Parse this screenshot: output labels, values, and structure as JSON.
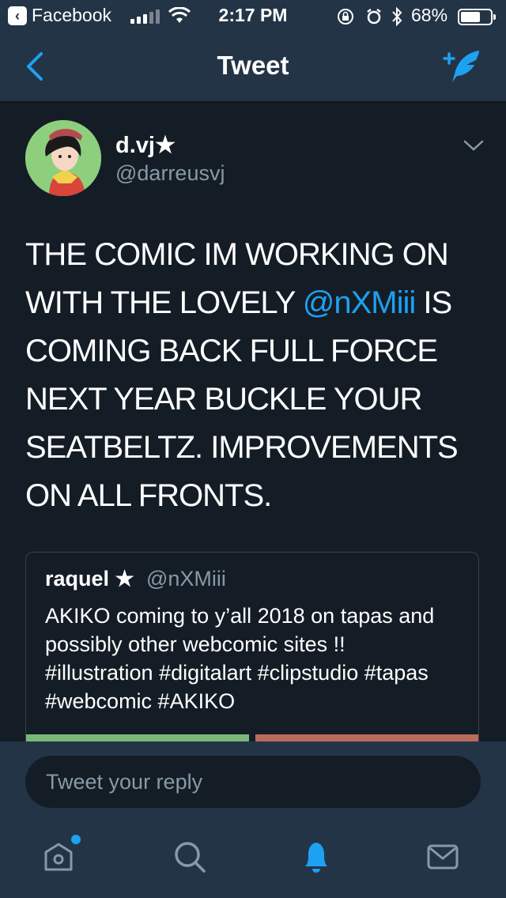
{
  "status_bar": {
    "back_app": "Facebook",
    "time": "2:17 PM",
    "battery_percent": "68%",
    "battery_level": 0.68
  },
  "nav": {
    "title": "Tweet",
    "back_icon": "chevron-left-icon",
    "compose_icon": "compose-tweet-icon"
  },
  "tweet": {
    "author_name": "d.vj★",
    "author_handle": "@darreusvj",
    "text_before_mention": "THE COMIC IM WORKING ON WITH THE LOVELY ",
    "mention": "@nXMiii",
    "text_after_mention": " IS COMING BACK FULL FORCE NEXT YEAR BUCKLE YOUR SEATBELTZ. IMPROVEMENTS ON ALL FRONTS."
  },
  "quoted_tweet": {
    "author_name": "raquel ★",
    "author_handle": "@nXMiii",
    "text": "AKIKO coming to y’all 2018 on tapas and possibly other webcomic sites !! #illustration #digitalart #clipstudio #tapas #webcomic #AKIKO"
  },
  "reply": {
    "placeholder": "Tweet your reply"
  },
  "tab_bar": {
    "items": [
      "home-icon",
      "search-icon",
      "notifications-icon",
      "messages-icon"
    ],
    "active": "notifications-icon"
  },
  "colors": {
    "background": "#141d26",
    "header": "#243447",
    "accent": "#1da1f2",
    "secondary_text": "#8899a6"
  }
}
